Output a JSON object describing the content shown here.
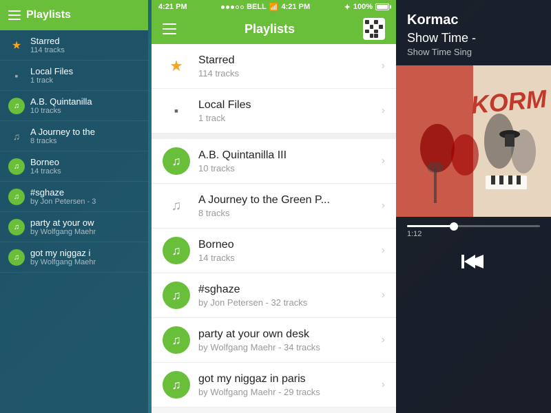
{
  "app": {
    "title": "Playlists"
  },
  "status_bar": {
    "time_left": "4:21 PM",
    "time_center": "4:21 PM",
    "carrier": "BELL",
    "battery": "100%",
    "signal_dots": [
      "filled",
      "filled",
      "filled",
      "empty",
      "empty"
    ]
  },
  "header": {
    "title": "Playlists",
    "menu_icon": "hamburger",
    "qr_icon": "qr-code"
  },
  "playlists": {
    "special": [
      {
        "id": "starred",
        "name": "Starred",
        "sub": "114 tracks",
        "icon_type": "star"
      },
      {
        "id": "local-files",
        "name": "Local Files",
        "sub": "1 track",
        "icon_type": "local"
      }
    ],
    "items": [
      {
        "id": "ab-quintanilla",
        "name": "A.B. Quintanilla III",
        "sub": "10 tracks",
        "icon_type": "green-music"
      },
      {
        "id": "journey-green",
        "name": "A Journey to the Green P...",
        "sub": "8 tracks",
        "icon_type": "gray-music"
      },
      {
        "id": "borneo",
        "name": "Borneo",
        "sub": "14 tracks",
        "icon_type": "green-music"
      },
      {
        "id": "sghaze",
        "name": "#sghaze",
        "sub": "by Jon Petersen - 32 tracks",
        "icon_type": "green-music"
      },
      {
        "id": "party-desk",
        "name": "party at your own desk",
        "sub": "by Wolfgang Maehr - 34 tracks",
        "icon_type": "green-music"
      },
      {
        "id": "niggaz-paris",
        "name": "got my niggaz in paris",
        "sub": "by Wolfgang Maehr - 29 tracks",
        "icon_type": "green-music"
      }
    ]
  },
  "left_panel": {
    "title": "Playlists",
    "items": [
      {
        "name": "Starred",
        "sub": "114 tracks",
        "icon": "star"
      },
      {
        "name": "Local Files",
        "sub": "1 track",
        "icon": "local"
      },
      {
        "name": "A.B. Quintanilla",
        "sub": "10 tracks",
        "icon": "green-music"
      },
      {
        "name": "A Journey to the",
        "sub": "8 tracks",
        "icon": "gray-music"
      },
      {
        "name": "Borneo",
        "sub": "14 tracks",
        "icon": "green-music"
      },
      {
        "name": "#sghaze",
        "sub": "by Jon Petersen - 3",
        "icon": "green-music"
      },
      {
        "name": "party at your ow",
        "sub": "by Wolfgang Maehr",
        "icon": "green-music"
      },
      {
        "name": "got my niggaz i",
        "sub": "by Wolfgang Maehr",
        "icon": "green-music"
      }
    ]
  },
  "right_panel": {
    "artist": "Kormac",
    "album": "Show Time -",
    "sub": "Show Time Sing",
    "progress_time": "1:12",
    "controls": {
      "skip_back": "⏮"
    }
  },
  "colors": {
    "green": "#6abf3a",
    "dark_bg": "#1a3a4a",
    "right_bg": "#1a1a28"
  }
}
